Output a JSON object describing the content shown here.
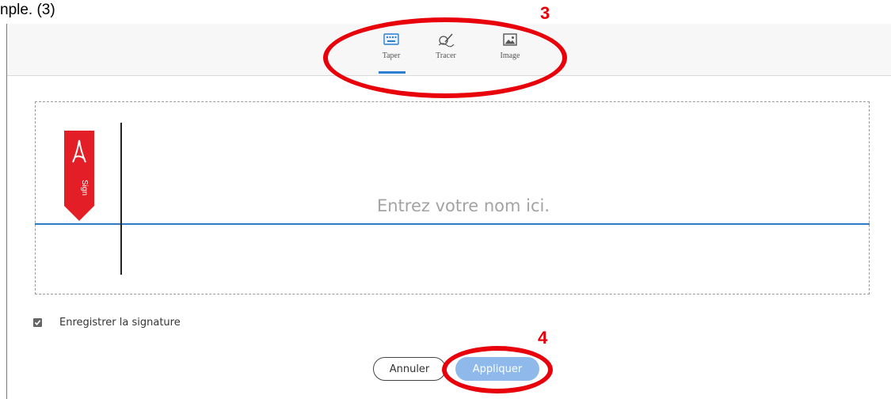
{
  "caption": "nple. (3)",
  "tabs": [
    {
      "label": "Taper",
      "icon": "keyboard-icon",
      "selected": true
    },
    {
      "label": "Tracer",
      "icon": "pen-signature-icon",
      "selected": false
    },
    {
      "label": "Image",
      "icon": "image-icon",
      "selected": false
    }
  ],
  "signature": {
    "placeholder": "Entrez votre nom ici.",
    "value": "",
    "badge_text": "Sign",
    "badge_color": "#e41e26"
  },
  "save_signature": {
    "label": "Enregistrer la signature",
    "checked": true
  },
  "buttons": {
    "cancel": "Annuler",
    "apply": "Appliquer"
  },
  "annotations": {
    "step_tabs": "3",
    "step_apply": "4",
    "color": "#e8000b"
  },
  "colors": {
    "accent": "#2d7fd3",
    "apply_button": "#8eb9ea"
  }
}
